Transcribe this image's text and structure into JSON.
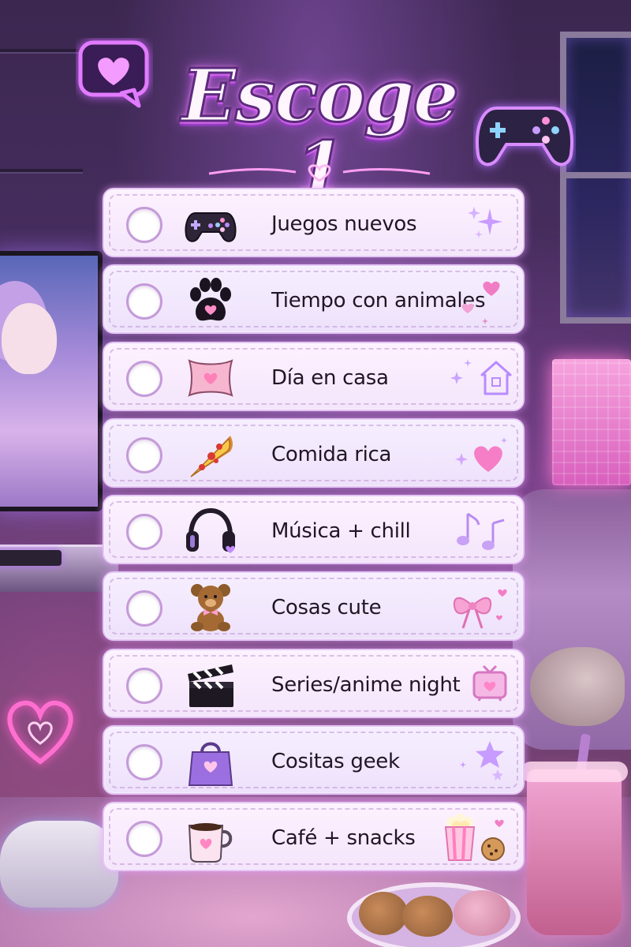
{
  "title": "Escoge 1",
  "colors": {
    "accent": "#d96bff",
    "card_border": "#e4c7f5",
    "radio_border": "#c49bd8",
    "text": "#201625"
  },
  "options": [
    {
      "label": "Juegos nuevos",
      "icon": "gamepad-icon",
      "deco": "sparkles-icon"
    },
    {
      "label": "Tiempo con animales",
      "icon": "paw-print-icon",
      "deco": "hearts-icon"
    },
    {
      "label": "Día en casa",
      "icon": "pillow-icon",
      "deco": "house-icon"
    },
    {
      "label": "Comida rica",
      "icon": "pizza-icon",
      "deco": "heart-icon"
    },
    {
      "label": "Música + chill",
      "icon": "headphones-icon",
      "deco": "music-notes-icon"
    },
    {
      "label": "Cosas cute",
      "icon": "teddy-bear-icon",
      "deco": "bow-icon"
    },
    {
      "label": "Series/anime night",
      "icon": "clapperboard-icon",
      "deco": "tv-icon"
    },
    {
      "label": "Cositas geek",
      "icon": "shopping-bag-icon",
      "deco": "stars-icon"
    },
    {
      "label": "Café + snacks",
      "icon": "coffee-mug-icon",
      "deco": "popcorn-cookie-icon"
    }
  ]
}
